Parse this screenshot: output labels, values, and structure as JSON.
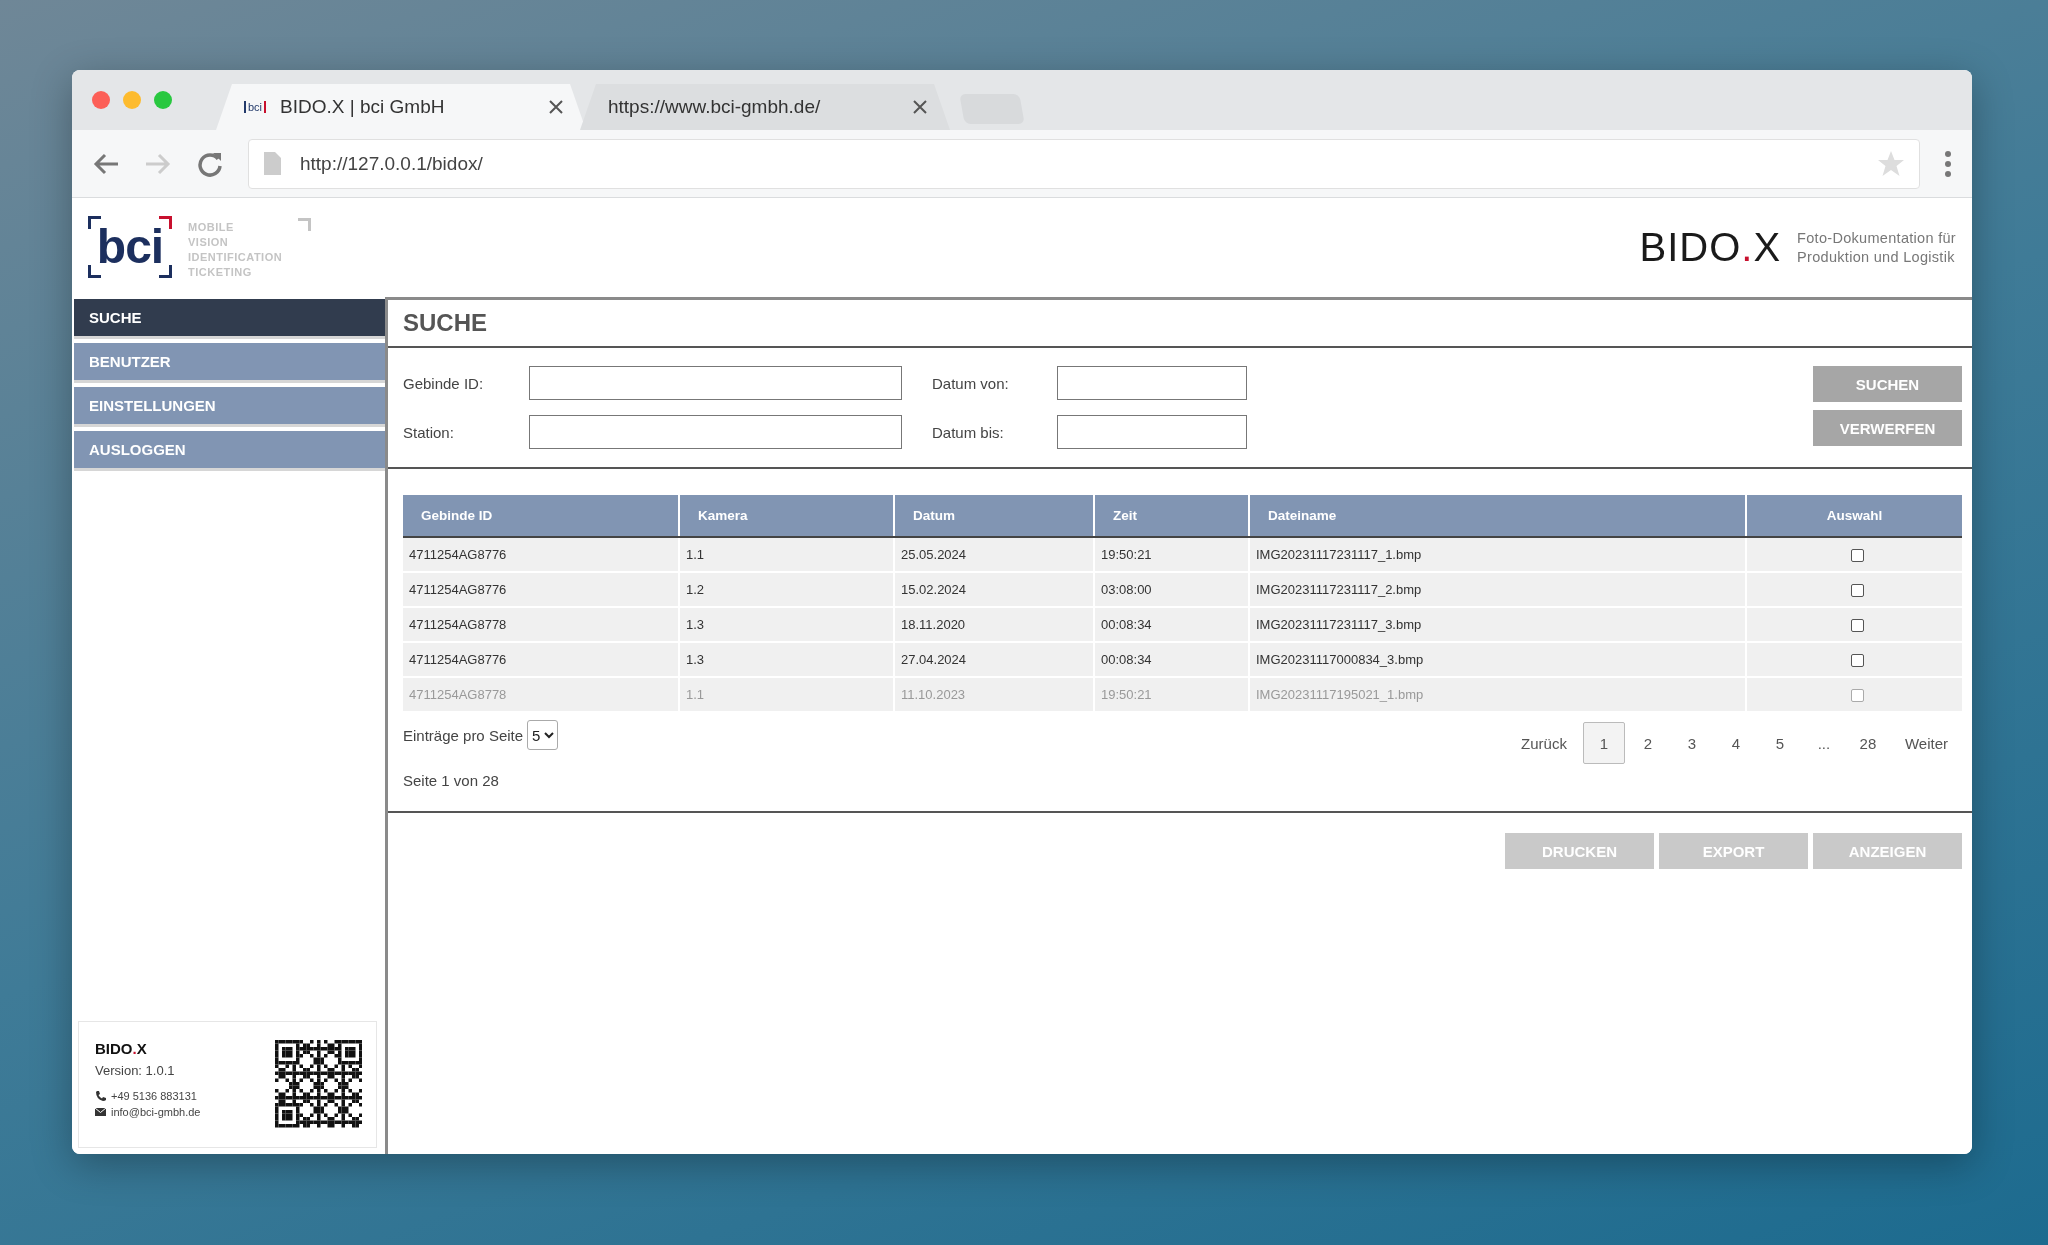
{
  "browser": {
    "tabs": [
      {
        "title": "BIDO.X | bci GmbH",
        "favicon": "bci",
        "selected": true
      },
      {
        "title": "https://www.bci-gmbh.de/",
        "selected": false
      }
    ],
    "address": "http://127.0.0.1/bidox/"
  },
  "header": {
    "logo": {
      "mark": "bci",
      "tagline": [
        "MOBILE",
        "VISION",
        "IDENTIFICATION",
        "TICKETING"
      ]
    },
    "product": "BIDO.X",
    "product_tagline": [
      "Foto-Dokumentation für",
      "Produktion und Logistik"
    ]
  },
  "sidebar": {
    "items": [
      {
        "label": "SUCHE",
        "selected": true
      },
      {
        "label": "BENUTZER",
        "selected": false
      },
      {
        "label": "EINSTELLUNGEN",
        "selected": false
      },
      {
        "label": "AUSLOGGEN",
        "selected": false
      }
    ],
    "info": {
      "title": "BIDO.X",
      "version": "Version: 1.0.1",
      "phone": "+49 5136 883131",
      "email": "info@bci-gmbh.de"
    }
  },
  "page_title": "SUCHE",
  "form": {
    "fields": [
      {
        "label": "Gebinde ID:"
      },
      {
        "label": "Datum von:"
      },
      {
        "label": "Station:"
      },
      {
        "label": "Datum bis:"
      }
    ],
    "buttons": [
      {
        "label": "SUCHEN",
        "disabled": false
      },
      {
        "label": "VERWERFEN",
        "disabled": false
      }
    ]
  },
  "table": {
    "columns": [
      "Gebinde ID",
      "Kamera",
      "Datum",
      "Zeit",
      "Dateiname",
      "Auswahl"
    ],
    "rows": [
      {
        "cells": [
          "4711254AG8776",
          "1.1",
          "25.05.2024",
          "19:50:21",
          "IMG20231117231117_1.bmp"
        ],
        "checked": false,
        "disabled": false
      },
      {
        "cells": [
          "4711254AG8776",
          "1.2",
          "15.02.2024",
          "03:08:00",
          "IMG20231117231117_2.bmp"
        ],
        "checked": false,
        "disabled": false
      },
      {
        "cells": [
          "4711254AG8778",
          "1.3",
          "18.11.2020",
          "00:08:34",
          "IMG20231117231117_3.bmp"
        ],
        "checked": false,
        "disabled": false
      },
      {
        "cells": [
          "4711254AG8776",
          "1.3",
          "27.04.2024",
          "00:08:34",
          "IMG20231117000834_3.bmp"
        ],
        "checked": false,
        "disabled": false
      },
      {
        "cells": [
          "4711254AG8778",
          "1.1",
          "11.10.2023",
          "19:50:21",
          "IMG20231117195021_1.bmp"
        ],
        "checked": false,
        "disabled": true
      }
    ]
  },
  "page_size": {
    "label": "Einträge pro Seite",
    "value": "5"
  },
  "page_info": "Seite 1 von 28",
  "pagination": {
    "previous": "Zurück",
    "pages": [
      {
        "label": "1",
        "selected": true
      },
      {
        "label": "2",
        "selected": false
      },
      {
        "label": "3",
        "selected": false
      },
      {
        "label": "4",
        "selected": false
      },
      {
        "label": "5",
        "selected": false
      },
      {
        "label": "...",
        "selected": false
      },
      {
        "label": "28",
        "selected": false
      }
    ],
    "next": "Weiter"
  },
  "actions": [
    {
      "label": "DRUCKEN",
      "disabled": true
    },
    {
      "label": "EXPORT",
      "disabled": true
    },
    {
      "label": "ANZEIGEN",
      "disabled": true
    }
  ]
}
